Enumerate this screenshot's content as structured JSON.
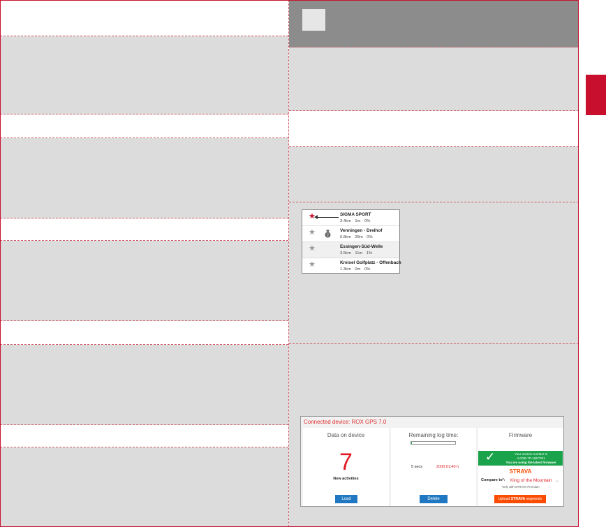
{
  "segments": {
    "rows": [
      {
        "title": "SIGMA SPORT",
        "stats": "3.4km 1m 0%",
        "starred": true,
        "icon": "star-icon"
      },
      {
        "title": "Venningen - Dreihof",
        "stats": "6.8km 28m 0%",
        "starred": false,
        "icon": "medal-icon"
      },
      {
        "title": "Essingen-Süd-Welle",
        "stats": "3.5km 11m 1%",
        "starred": false,
        "icon": "star-icon"
      },
      {
        "title": "Kreisel Golfplatz - Offenbach",
        "stats": "1.3km 0m 0%",
        "starred": false,
        "icon": "star-icon"
      }
    ]
  },
  "device": {
    "connected": "Connected device: ROX GPS 7.0",
    "data_panel": {
      "title": "Data on device",
      "count": "7",
      "count_label": "New activities",
      "button": "Load"
    },
    "log_panel": {
      "title": "Remaining log time:",
      "label": "5 secs",
      "value": "2000:01:40 h",
      "button": "Delete",
      "progress": 0.02
    },
    "firmware_panel": {
      "title": "Firmware",
      "version_label": "Your version number is",
      "version": "4-0GB-7P-16E/79/1",
      "latest": "You are using the latest firmware",
      "brand": "STRAVA",
      "compare_label": "Compare to*:",
      "compare_value": "King of the Mountain",
      "premium_note": "*only with STRAVA Premium",
      "upload_prefix": "Upload",
      "upload_brand": "STRAVA",
      "upload_suffix": "segments"
    }
  },
  "colors": {
    "accent": "#c8102e",
    "header_gray": "#8c8c8c",
    "band_gray": "#dcdcdc",
    "green": "#1aa34a",
    "strava": "#fc4c02",
    "button_blue": "#1f78c1"
  }
}
